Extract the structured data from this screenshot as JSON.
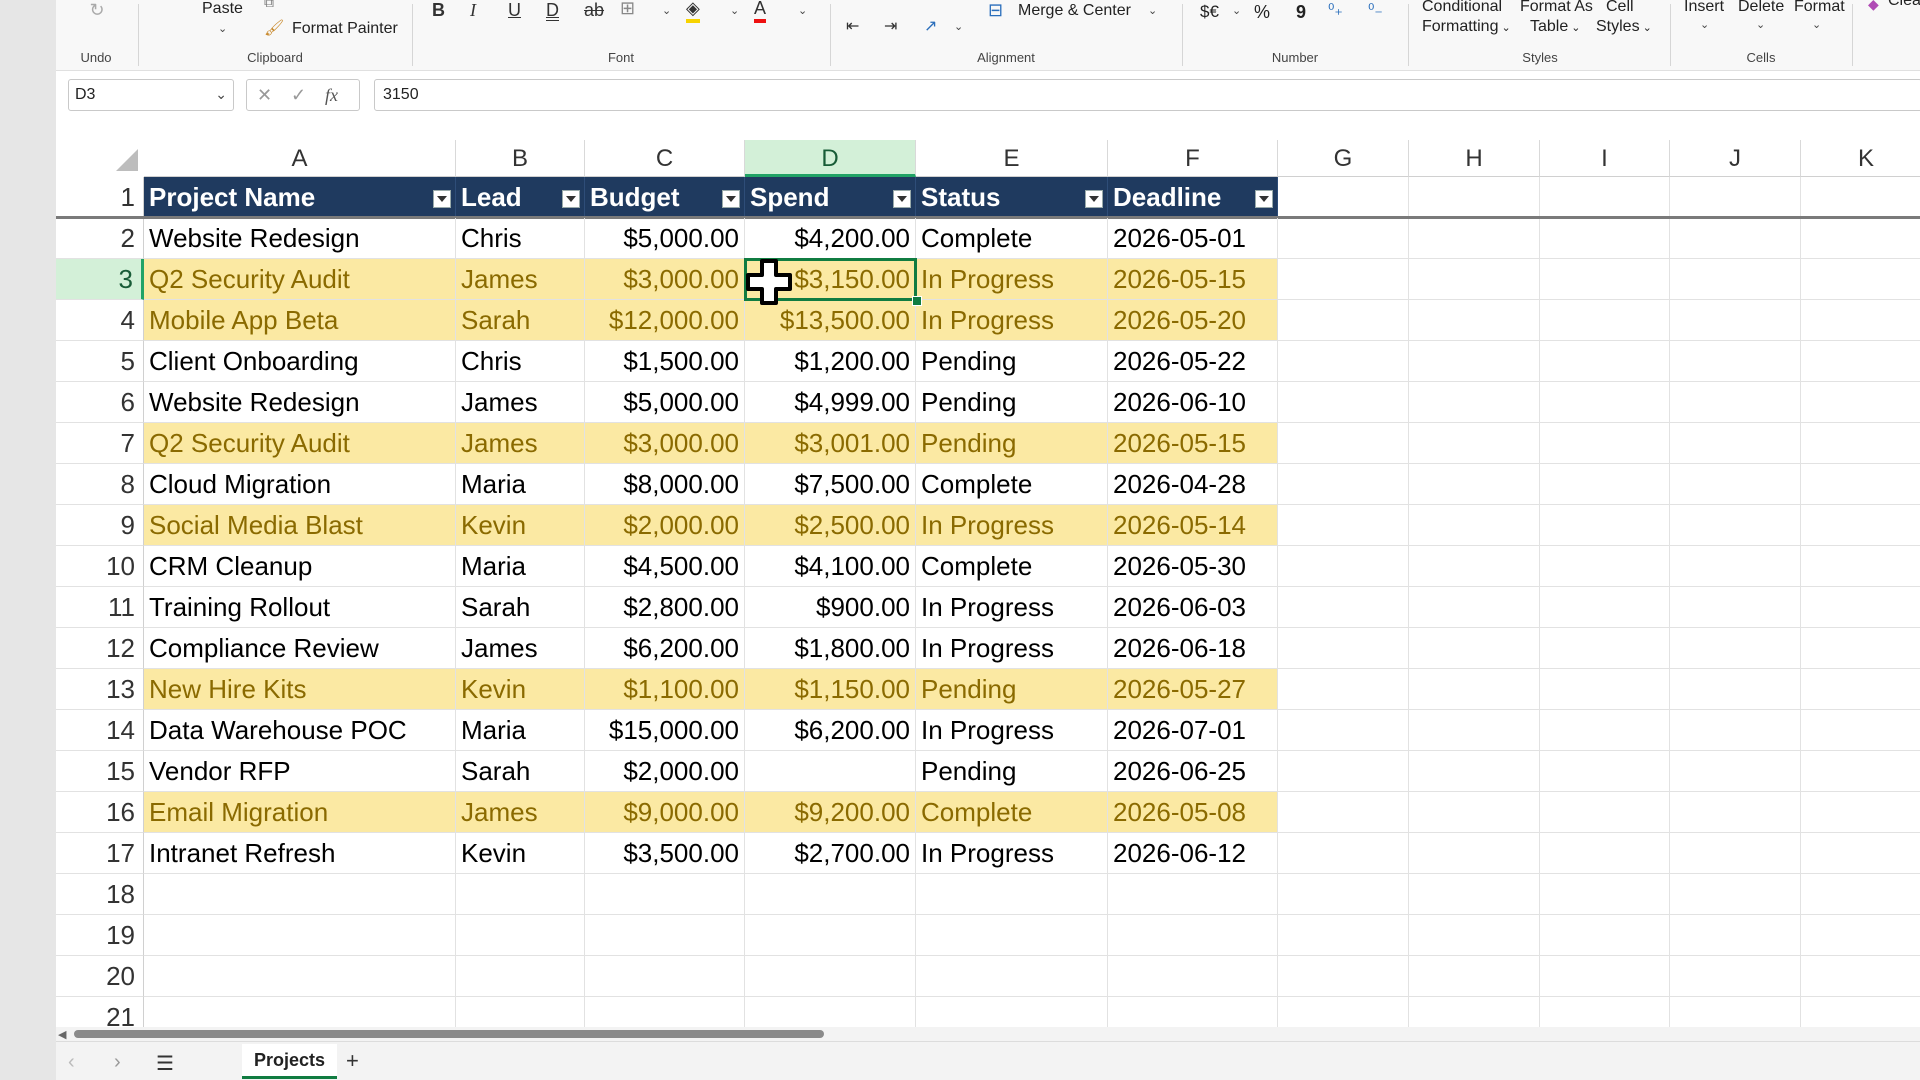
{
  "ribbon": {
    "undo": {
      "label": "Undo"
    },
    "clipboard": {
      "group": "Clipboard",
      "paste": "Paste",
      "copy": "Copy",
      "format_painter": "Format Painter"
    },
    "font": {
      "group": "Font"
    },
    "alignment": {
      "group": "Alignment",
      "merge": "Merge & Center"
    },
    "number": {
      "group": "Number",
      "currency": "$€",
      "percent": "%",
      "comma": "9"
    },
    "styles": {
      "group": "Styles",
      "cond_1": "Conditional",
      "cond_2": "Formatting",
      "fmt_table_1": "Format As",
      "fmt_table_2": "Table",
      "cell_styles_1": "Cell",
      "cell_styles_2": "Styles"
    },
    "cells": {
      "group": "Cells",
      "insert": "Insert",
      "delete": "Delete",
      "format": "Format"
    },
    "clear": "Clear"
  },
  "formula_bar": {
    "name_box": "D3",
    "value": "3150",
    "fx": "fx"
  },
  "grid": {
    "columns": [
      "A",
      "B",
      "C",
      "D",
      "E",
      "F",
      "G",
      "H",
      "I",
      "J",
      "K"
    ],
    "selected_column": "D",
    "selected_row": 3,
    "rows": [
      "1",
      "2",
      "3",
      "4",
      "5",
      "6",
      "7",
      "8",
      "9",
      "10",
      "11",
      "12",
      "13",
      "14",
      "15",
      "16",
      "17",
      "18",
      "19",
      "20",
      "21"
    ],
    "table_headers": [
      "Project Name",
      "Lead",
      "Budget",
      "Spend",
      "Status",
      "Deadline"
    ],
    "table_rows": [
      {
        "cells": [
          "Website Redesign",
          "Chris",
          "$5,000.00",
          "$4,200.00",
          "Complete",
          "2026-05-01"
        ],
        "highlight": false
      },
      {
        "cells": [
          "Q2 Security Audit",
          "James",
          "$3,000.00",
          "$3,150.00",
          "In Progress",
          "2026-05-15"
        ],
        "highlight": true
      },
      {
        "cells": [
          "Mobile App Beta",
          "Sarah",
          "$12,000.00",
          "$13,500.00",
          "In Progress",
          "2026-05-20"
        ],
        "highlight": true
      },
      {
        "cells": [
          "Client Onboarding",
          "Chris",
          "$1,500.00",
          "$1,200.00",
          "Pending",
          "2026-05-22"
        ],
        "highlight": false
      },
      {
        "cells": [
          "Website Redesign",
          "James",
          "$5,000.00",
          "$4,999.00",
          "Pending",
          "2026-06-10"
        ],
        "highlight": false
      },
      {
        "cells": [
          "Q2 Security Audit",
          "James",
          "$3,000.00",
          "$3,001.00",
          "Pending",
          "2026-05-15"
        ],
        "highlight": true
      },
      {
        "cells": [
          "Cloud Migration",
          "Maria",
          "$8,000.00",
          "$7,500.00",
          "Complete",
          "2026-04-28"
        ],
        "highlight": false
      },
      {
        "cells": [
          "Social Media Blast",
          "Kevin",
          "$2,000.00",
          "$2,500.00",
          "In Progress",
          "2026-05-14"
        ],
        "highlight": true
      },
      {
        "cells": [
          "CRM Cleanup",
          "Maria",
          "$4,500.00",
          "$4,100.00",
          "Complete",
          "2026-05-30"
        ],
        "highlight": false
      },
      {
        "cells": [
          "Training Rollout",
          "Sarah",
          "$2,800.00",
          "$900.00",
          "In Progress",
          "2026-06-03"
        ],
        "highlight": false
      },
      {
        "cells": [
          "Compliance Review",
          "James",
          "$6,200.00",
          "$1,800.00",
          "In Progress",
          "2026-06-18"
        ],
        "highlight": false
      },
      {
        "cells": [
          "New Hire Kits",
          "Kevin",
          "$1,100.00",
          "$1,150.00",
          "Pending",
          "2026-05-27"
        ],
        "highlight": true
      },
      {
        "cells": [
          "Data Warehouse POC",
          "Maria",
          "$15,000.00",
          "$6,200.00",
          "In Progress",
          "2026-07-01"
        ],
        "highlight": false
      },
      {
        "cells": [
          "Vendor RFP",
          "Sarah",
          "$2,000.00",
          "",
          "Pending",
          "2026-06-25"
        ],
        "highlight": false
      },
      {
        "cells": [
          "Email Migration",
          "James",
          "$9,000.00",
          "$9,200.00",
          "Complete",
          "2026-05-08"
        ],
        "highlight": true
      },
      {
        "cells": [
          "Intranet Refresh",
          "Kevin",
          "$3,500.00",
          "$2,700.00",
          "In Progress",
          "2026-06-12"
        ],
        "highlight": false
      }
    ]
  },
  "sheet_tabs": {
    "active": "Projects"
  },
  "colors": {
    "header_bg": "#1f3a5f",
    "highlight_bg": "#fbe9a3",
    "highlight_text": "#8a6a00",
    "selection": "#107c41"
  }
}
